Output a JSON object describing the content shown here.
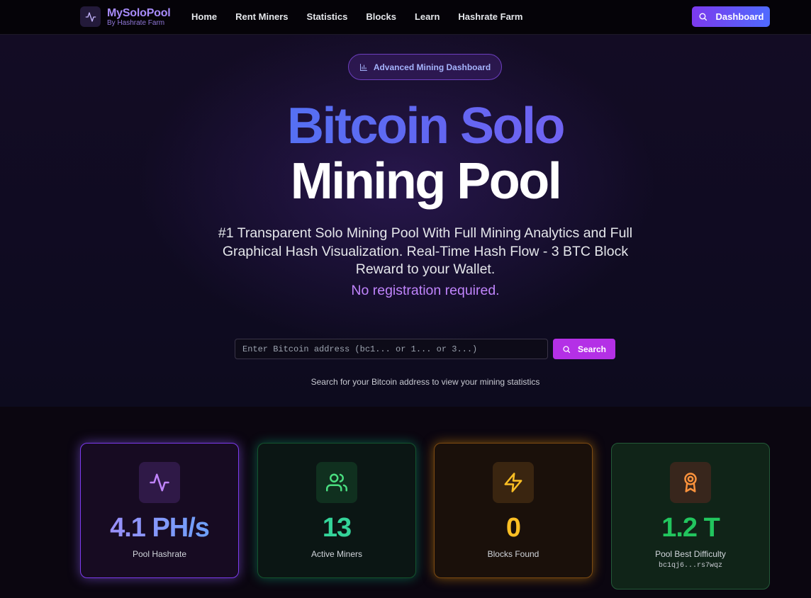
{
  "nav": {
    "brand_name": "MySoloPool",
    "brand_sub": "By Hashrate Farm",
    "links": [
      "Home",
      "Rent Miners",
      "Statistics",
      "Blocks",
      "Learn",
      "Hashrate Farm"
    ],
    "dashboard_label": "Dashboard"
  },
  "hero": {
    "pill_label": "Advanced Mining Dashboard",
    "title_line1": "Bitcoin Solo",
    "title_line2": "Mining Pool",
    "tagline": "#1 Transparent Solo Mining Pool With Full Mining Analytics and Full Graphical Hash Visualization. Real-Time Hash Flow - 3 BTC Block Reward to your Wallet.",
    "no_registration": "No registration required.",
    "search_placeholder": "Enter Bitcoin address (bc1... or 1... or 3...)",
    "search_button": "Search",
    "search_hint": "Search for your Bitcoin address to view your mining statistics"
  },
  "stats": [
    {
      "value": "4.1 PH/s",
      "label": "Pool Hashrate",
      "icon": "activity-icon"
    },
    {
      "value": "13",
      "label": "Active Miners",
      "icon": "users-icon"
    },
    {
      "value": "0",
      "label": "Blocks Found",
      "icon": "lightning-icon"
    },
    {
      "value": "1.2 T",
      "label": "Pool Best Difficulty",
      "address": "bc1qj6...rs7wqz",
      "icon": "award-icon"
    }
  ],
  "colors": {
    "accent_purple": "#a78bfa",
    "accent_blue": "#3b82f6",
    "search_button": "#b430e6",
    "green": "#34d399",
    "amber": "#fbbf24"
  }
}
